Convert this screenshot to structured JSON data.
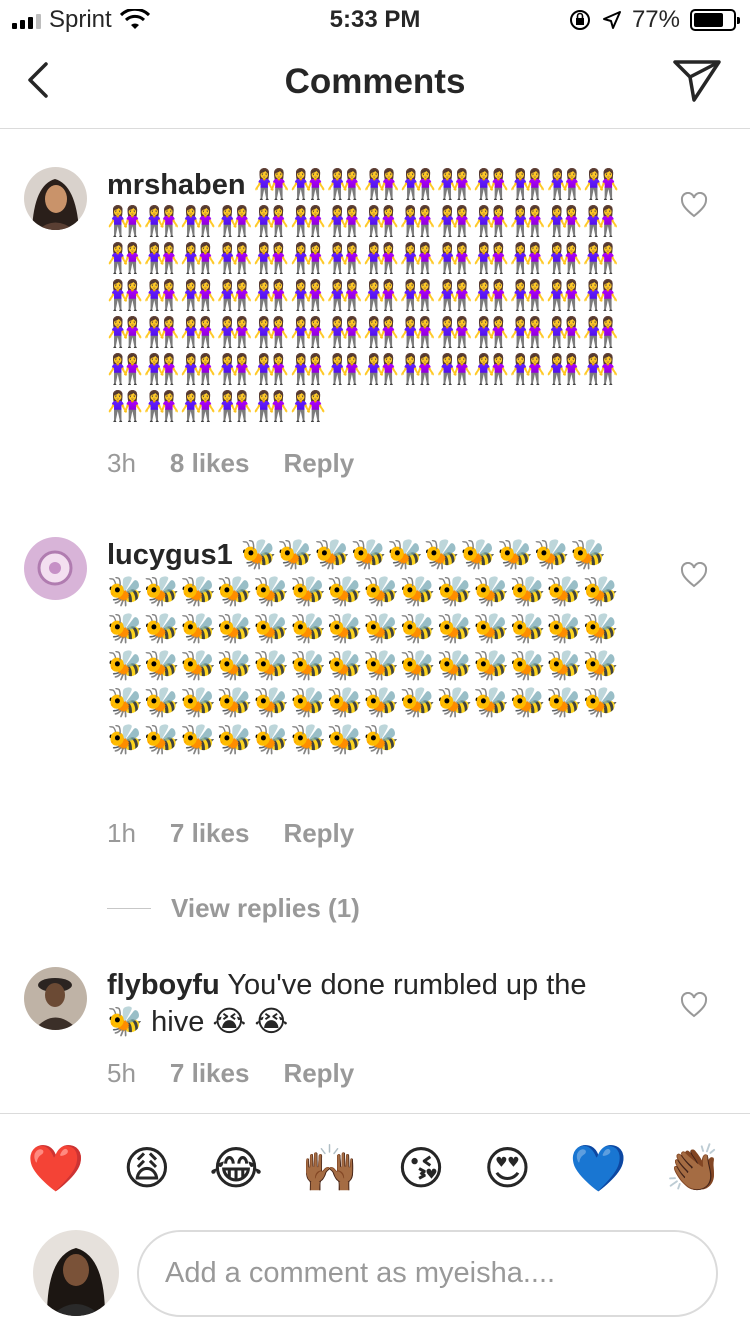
{
  "status_bar": {
    "carrier": "Sprint",
    "time": "5:33 PM",
    "battery": "77%",
    "battery_level": 0.77
  },
  "header": {
    "title": "Comments"
  },
  "comments": [
    {
      "username": "mrshaben",
      "text": "👭👭👭👭👭👭👭👭👭👭👭👭👭👭👭👭👭👭👭👭👭👭👭👭👭👭👭👭👭👭👭👭👭👭👭👭👭👭👭👭👭👭👭👭👭👭👭👭👭👭👭👭👭👭👭👭👭👭👭👭👭👭👭👭👭👭👭👭👭👭👭👭👭👭👭👭👭👭👭👭👭👭👭👭👭👭",
      "time": "3h",
      "likes": "8 likes",
      "reply": "Reply"
    },
    {
      "username": "lucygus1",
      "text": "🐝🐝🐝🐝🐝🐝🐝🐝🐝🐝🐝🐝🐝🐝🐝🐝🐝🐝🐝🐝🐝🐝🐝🐝🐝🐝🐝🐝🐝🐝🐝🐝🐝🐝🐝🐝🐝🐝🐝🐝🐝🐝🐝🐝🐝🐝🐝🐝🐝🐝🐝🐝🐝🐝🐝🐝🐝🐝🐝🐝🐝🐝🐝🐝🐝🐝🐝🐝🐝🐝🐝🐝🐝🐝",
      "time": "1h",
      "likes": "7 likes",
      "reply": "Reply",
      "view_replies": "View replies (1)"
    },
    {
      "username": "flyboyfu",
      "text": "You've done rumbled up the 🐝 hive 😭 😭",
      "time": "5h",
      "likes": "7 likes",
      "reply": "Reply"
    }
  ],
  "quick_emojis": [
    "❤️",
    "😩",
    "😂",
    "🙌🏾",
    "😘",
    "😍",
    "💙",
    "👏🏾"
  ],
  "composer": {
    "placeholder": "Add a comment as myeisha...."
  }
}
